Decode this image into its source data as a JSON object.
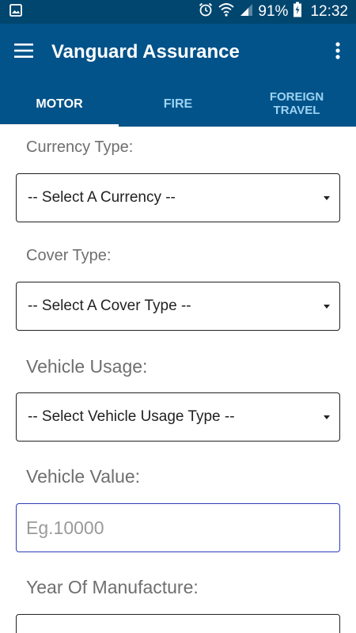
{
  "status_bar": {
    "battery": "91%",
    "time": "12:32",
    "icons": [
      "image-icon",
      "alarm-icon",
      "wifi-icon",
      "signal-icon",
      "battery-charging-icon"
    ]
  },
  "app_bar": {
    "title": "Vanguard Assurance",
    "icons": [
      "menu-icon",
      "overflow-menu-icon"
    ]
  },
  "tabs": [
    {
      "label": "MOTOR",
      "active": true
    },
    {
      "label": "FIRE",
      "active": false
    },
    {
      "label": "FOREIGN\nTRAVEL",
      "active": false
    }
  ],
  "form": {
    "currency": {
      "label": "Currency Type:",
      "selected": "-- Select A Currency --"
    },
    "cover": {
      "label": "Cover Type:",
      "selected": "-- Select A Cover Type --"
    },
    "usage": {
      "label": "Vehicle Usage:",
      "selected": "-- Select Vehicle Usage Type --"
    },
    "value": {
      "label": "Vehicle Value:",
      "placeholder": "Eg.10000",
      "value": ""
    },
    "year": {
      "label": "Year Of Manufacture:"
    }
  },
  "colors": {
    "status_bar": "#01466f",
    "app_bar": "#01538a",
    "tab_inactive": "#9ed3f2",
    "label_gray": "#6f6f6f",
    "input_focus_border": "#2c3fb8"
  }
}
